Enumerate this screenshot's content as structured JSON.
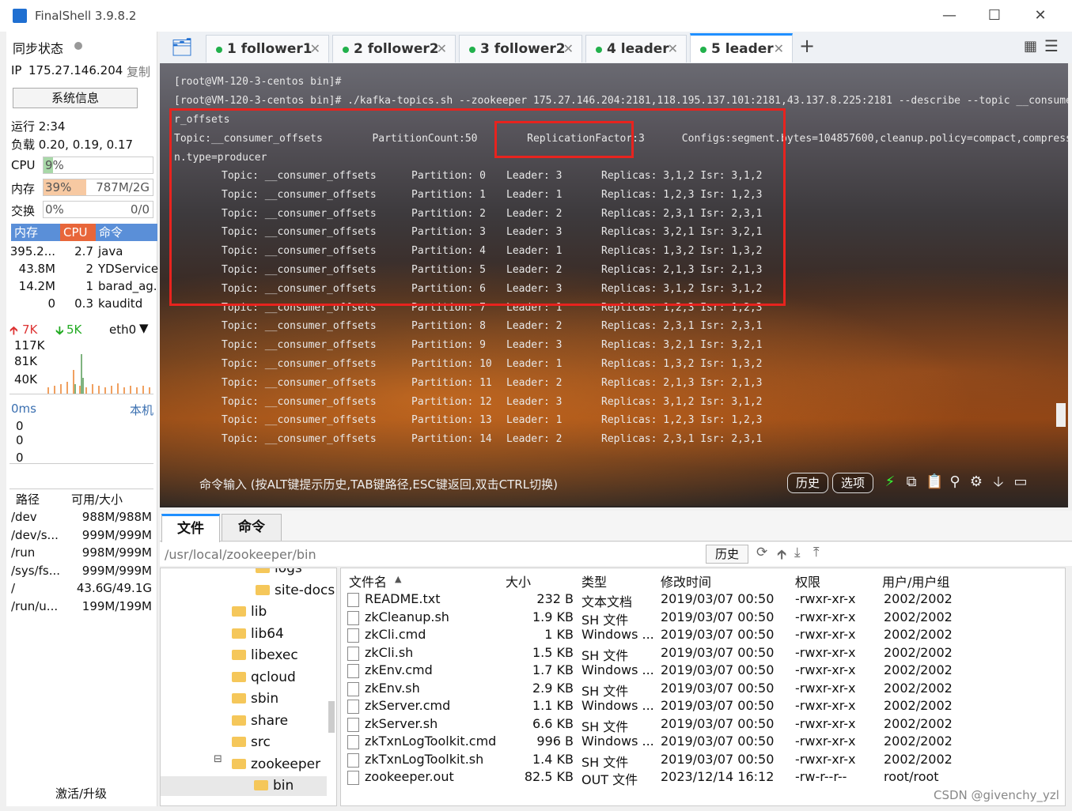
{
  "window": {
    "title": "FinalShell 3.9.8.2"
  },
  "sidebar": {
    "sync_label": "同步状态",
    "ip_label": "IP",
    "ip_value": "175.27.146.204",
    "copy_label": "复制",
    "sysinfo_button": "系统信息",
    "uptime": "运行 2:34",
    "load": "负载 0.20, 0.19, 0.17",
    "cpu_label": "CPU",
    "cpu_value": "9%",
    "cpu_fraction": 0.09,
    "mem_label": "内存",
    "mem_percent": "39%",
    "mem_fraction": 0.39,
    "mem_usage": "787M/2G",
    "swap_label": "交换",
    "swap_percent": "0%",
    "swap_usage": "0/0",
    "proc_headers": [
      "内存",
      "CPU",
      "命令"
    ],
    "processes": [
      {
        "mem": "395.2...",
        "cpu": "2.7",
        "cmd": "java"
      },
      {
        "mem": "43.8M",
        "cpu": "2",
        "cmd": "YDService"
      },
      {
        "mem": "14.2M",
        "cpu": "1",
        "cmd": "barad_ag."
      },
      {
        "mem": "0",
        "cpu": "0.3",
        "cmd": "kauditd"
      }
    ],
    "net_up": "7K",
    "net_down": "5K",
    "net_iface": "eth0",
    "net_scale": [
      "117K",
      "81K",
      "40K"
    ],
    "ping_label": "0ms",
    "ping_target": "本机",
    "ping_scale": [
      "0",
      "0",
      "0"
    ],
    "disk_headers": [
      "路径",
      "可用/大小"
    ],
    "disks": [
      {
        "path": "/dev",
        "size": "988M/988M"
      },
      {
        "path": "/dev/s...",
        "size": "999M/999M"
      },
      {
        "path": "/run",
        "size": "998M/999M"
      },
      {
        "path": "/sys/fs...",
        "size": "999M/999M"
      },
      {
        "path": "/",
        "size": "43.6G/49.1G"
      },
      {
        "path": "/run/u...",
        "size": "199M/199M"
      }
    ],
    "activate": "激活/升级"
  },
  "tabs": [
    {
      "num": "1",
      "label": "follower1"
    },
    {
      "num": "2",
      "label": "follower2"
    },
    {
      "num": "3",
      "label": "follower2"
    },
    {
      "num": "4",
      "label": "leader"
    },
    {
      "num": "5",
      "label": "leader"
    }
  ],
  "terminal": {
    "lines": [
      "[root@VM-120-3-centos bin]#",
      "[root@VM-120-3-centos bin]# ./kafka-topics.sh --zookeeper 175.27.146.204:2181,118.195.137.101:2181,43.137.8.225:2181 --describe --topic __consume",
      "r_offsets",
      "Topic:__consumer_offsets        PartitionCount:50        ReplicationFactor:3      Configs:segment.bytes=104857600,cleanup.policy=compact,compressio",
      "n.type=producer"
    ],
    "partitions": [
      {
        "topic": "Topic: __consumer_offsets",
        "partition": "Partition: 0",
        "leader": "Leader: 3",
        "replicas": "Replicas: 3,1,2 Isr: 3,1,2"
      },
      {
        "topic": "Topic: __consumer_offsets",
        "partition": "Partition: 1",
        "leader": "Leader: 1",
        "replicas": "Replicas: 1,2,3 Isr: 1,2,3"
      },
      {
        "topic": "Topic: __consumer_offsets",
        "partition": "Partition: 2",
        "leader": "Leader: 2",
        "replicas": "Replicas: 2,3,1 Isr: 2,3,1"
      },
      {
        "topic": "Topic: __consumer_offsets",
        "partition": "Partition: 3",
        "leader": "Leader: 3",
        "replicas": "Replicas: 3,2,1 Isr: 3,2,1"
      },
      {
        "topic": "Topic: __consumer_offsets",
        "partition": "Partition: 4",
        "leader": "Leader: 1",
        "replicas": "Replicas: 1,3,2 Isr: 1,3,2"
      },
      {
        "topic": "Topic: __consumer_offsets",
        "partition": "Partition: 5",
        "leader": "Leader: 2",
        "replicas": "Replicas: 2,1,3 Isr: 2,1,3"
      },
      {
        "topic": "Topic: __consumer_offsets",
        "partition": "Partition: 6",
        "leader": "Leader: 3",
        "replicas": "Replicas: 3,1,2 Isr: 3,1,2"
      },
      {
        "topic": "Topic: __consumer_offsets",
        "partition": "Partition: 7",
        "leader": "Leader: 1",
        "replicas": "Replicas: 1,2,3 Isr: 1,2,3"
      },
      {
        "topic": "Topic: __consumer_offsets",
        "partition": "Partition: 8",
        "leader": "Leader: 2",
        "replicas": "Replicas: 2,3,1 Isr: 2,3,1"
      },
      {
        "topic": "Topic: __consumer_offsets",
        "partition": "Partition: 9",
        "leader": "Leader: 3",
        "replicas": "Replicas: 3,2,1 Isr: 3,2,1"
      },
      {
        "topic": "Topic: __consumer_offsets",
        "partition": "Partition: 10",
        "leader": "Leader: 1",
        "replicas": "Replicas: 1,3,2 Isr: 1,3,2"
      },
      {
        "topic": "Topic: __consumer_offsets",
        "partition": "Partition: 11",
        "leader": "Leader: 2",
        "replicas": "Replicas: 2,1,3 Isr: 2,1,3"
      },
      {
        "topic": "Topic: __consumer_offsets",
        "partition": "Partition: 12",
        "leader": "Leader: 3",
        "replicas": "Replicas: 3,1,2 Isr: 3,1,2"
      },
      {
        "topic": "Topic: __consumer_offsets",
        "partition": "Partition: 13",
        "leader": "Leader: 1",
        "replicas": "Replicas: 1,2,3 Isr: 1,2,3"
      },
      {
        "topic": "Topic: __consumer_offsets",
        "partition": "Partition: 14",
        "leader": "Leader: 2",
        "replicas": "Replicas: 2,3,1 Isr: 2,3,1"
      }
    ],
    "cmd_hint": "命令输入 (按ALT键提示历史,TAB键路径,ESC键返回,双击CTRL切换)",
    "history_button": "历史",
    "options_button": "选项"
  },
  "bottom": {
    "tab_files": "文件",
    "tab_commands": "命令",
    "path": "/usr/local/zookeeper/bin",
    "history_button": "历史",
    "tree": [
      "logs",
      "site-docs",
      "lib",
      "lib64",
      "libexec",
      "qcloud",
      "sbin",
      "share",
      "src",
      "zookeeper",
      "bin"
    ],
    "columns": [
      "文件名",
      "大小",
      "类型",
      "修改时间",
      "权限",
      "用户/用户组"
    ],
    "files": [
      {
        "name": "README.txt",
        "size": "232 B",
        "type": "文本文档",
        "mtime": "2019/03/07 00:50",
        "perm": "-rwxr-xr-x",
        "owner": "2002/2002"
      },
      {
        "name": "zkCleanup.sh",
        "size": "1.9 KB",
        "type": "SH 文件",
        "mtime": "2019/03/07 00:50",
        "perm": "-rwxr-xr-x",
        "owner": "2002/2002"
      },
      {
        "name": "zkCli.cmd",
        "size": "1 KB",
        "type": "Windows ...",
        "mtime": "2019/03/07 00:50",
        "perm": "-rwxr-xr-x",
        "owner": "2002/2002"
      },
      {
        "name": "zkCli.sh",
        "size": "1.5 KB",
        "type": "SH 文件",
        "mtime": "2019/03/07 00:50",
        "perm": "-rwxr-xr-x",
        "owner": "2002/2002"
      },
      {
        "name": "zkEnv.cmd",
        "size": "1.7 KB",
        "type": "Windows ...",
        "mtime": "2019/03/07 00:50",
        "perm": "-rwxr-xr-x",
        "owner": "2002/2002"
      },
      {
        "name": "zkEnv.sh",
        "size": "2.9 KB",
        "type": "SH 文件",
        "mtime": "2019/03/07 00:50",
        "perm": "-rwxr-xr-x",
        "owner": "2002/2002"
      },
      {
        "name": "zkServer.cmd",
        "size": "1.1 KB",
        "type": "Windows ...",
        "mtime": "2019/03/07 00:50",
        "perm": "-rwxr-xr-x",
        "owner": "2002/2002"
      },
      {
        "name": "zkServer.sh",
        "size": "6.6 KB",
        "type": "SH 文件",
        "mtime": "2019/03/07 00:50",
        "perm": "-rwxr-xr-x",
        "owner": "2002/2002"
      },
      {
        "name": "zkTxnLogToolkit.cmd",
        "size": "996 B",
        "type": "Windows ...",
        "mtime": "2019/03/07 00:50",
        "perm": "-rwxr-xr-x",
        "owner": "2002/2002"
      },
      {
        "name": "zkTxnLogToolkit.sh",
        "size": "1.4 KB",
        "type": "SH 文件",
        "mtime": "2019/03/07 00:50",
        "perm": "-rwxr-xr-x",
        "owner": "2002/2002"
      },
      {
        "name": "zookeeper.out",
        "size": "82.5 KB",
        "type": "OUT 文件",
        "mtime": "2023/12/14 16:12",
        "perm": "-rw-r--r--",
        "owner": "root/root"
      }
    ]
  },
  "watermark": "CSDN @givenchy_yzl",
  "colors": {
    "accent": "#1f8fff",
    "highlight_box": "#e8231e",
    "proc_header": "#5a8fd8",
    "cpu_header": "#e8663a",
    "online_dot": "#22b14c"
  }
}
